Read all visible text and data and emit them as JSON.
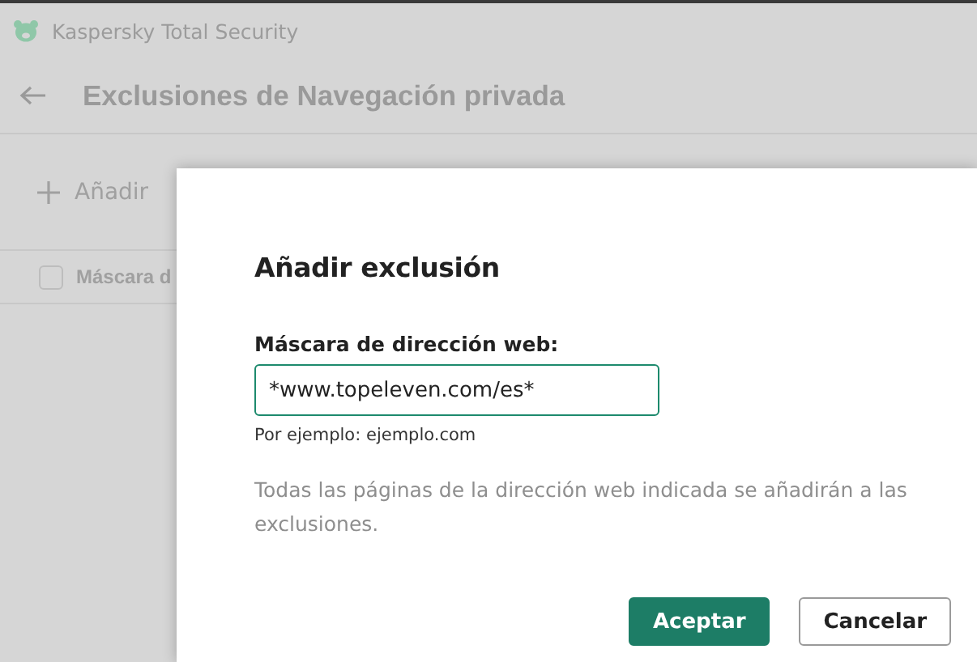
{
  "window": {
    "title": "Kaspersky Total Security"
  },
  "page": {
    "title": "Exclusiones de Navegación privada",
    "add_label": "Añadir",
    "table": {
      "select_all_checked": false,
      "column_1": "Máscara d"
    }
  },
  "dialog": {
    "title": "Añadir exclusión",
    "field": {
      "label": "Máscara de dirección web:",
      "value": "*www.topeleven.com/es*",
      "hint": "Por ejemplo: ejemplo.com"
    },
    "description": "Todas las páginas de la dirección web indicada se añadirán a las exclusiones.",
    "buttons": [
      {
        "label": "Aceptar",
        "kind": "primary"
      },
      {
        "label": "Cancelar",
        "kind": "secondary"
      }
    ]
  }
}
